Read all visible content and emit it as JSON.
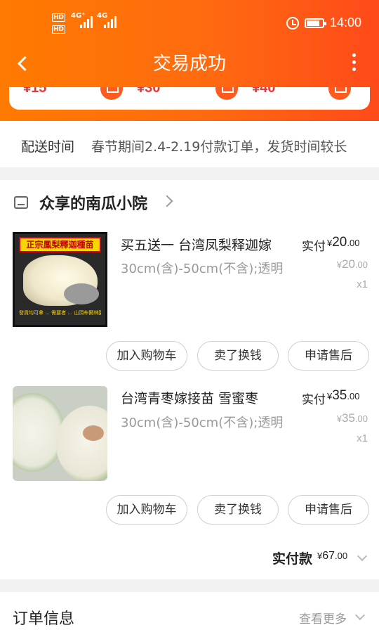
{
  "status_bar": {
    "hd_badge": "HD",
    "network_1": "4G⁺",
    "network_2": "4G",
    "time": "14:00"
  },
  "header": {
    "title": "交易成功"
  },
  "recommendations": {
    "prices": [
      "¥15",
      "¥30",
      "¥40"
    ]
  },
  "delivery": {
    "label": "配送时间",
    "text": "春节期间2.4-2.19付款订单，发货时间较长"
  },
  "shop": {
    "name": "众享的南瓜小院",
    "items": [
      {
        "title": "买五送一 台湾凤梨释迦嫁",
        "spec": "30cm(含)-50cm(不含);透明",
        "paid_label": "实付",
        "paid_currency": "¥",
        "paid_int": "20",
        "paid_dec": ".00",
        "orig_currency": "¥",
        "orig_int": "20",
        "orig_dec": ".00",
        "qty": "x1",
        "image_banner": "正宗鳳梨釋迦種苗",
        "image_caption": "發貨均可拿 ... 需要者 ... 山頂布爾林園"
      },
      {
        "title": "台湾青枣嫁接苗 雪蜜枣",
        "spec": "30cm(含)-50cm(不含);透明",
        "paid_label": "实付",
        "paid_currency": "¥",
        "paid_int": "35",
        "paid_dec": ".00",
        "orig_currency": "¥",
        "orig_int": "35",
        "orig_dec": ".00",
        "qty": "x1"
      }
    ],
    "buttons": {
      "add_to_cart": "加入购物车",
      "sell": "卖了换钱",
      "after_sale": "申请售后"
    },
    "total_label": "实付款",
    "total_currency": "¥",
    "total_int": "67",
    "total_dec": ".00"
  },
  "order_info": {
    "title": "订单信息",
    "more": "查看更多"
  },
  "colors": {
    "header_start": "#ff7a00",
    "header_end": "#ff4a1a",
    "accent_price": "#e4393c"
  },
  "icons": [
    "back-icon",
    "more-icon",
    "cart-icon",
    "store-icon",
    "chevron-right-icon",
    "chevron-down-icon",
    "alarm-icon",
    "battery-icon"
  ]
}
